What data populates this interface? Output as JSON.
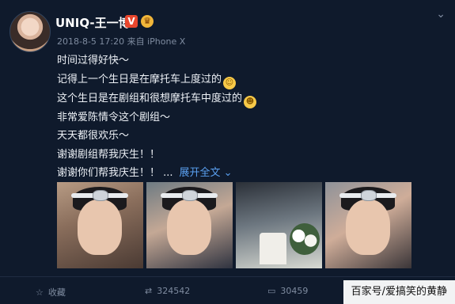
{
  "post": {
    "username": "UNIQ-王一博",
    "verified_badge": "V",
    "meta": "2018-8-5 17:20 来自 iPhone X",
    "lines": [
      "时间过得好快～",
      "记得上一个生日是在摩托车上度过的",
      "这个生日是在剧组和很想摩托车中度过的",
      "非常爱陈情令这个剧组～",
      "天天都很欢乐～",
      "谢谢剧组帮我庆生！！",
      "谢谢你们帮我庆生！！ ..."
    ],
    "expand_label": "展开全文 ⌄"
  },
  "actions": {
    "favorite_label": "收藏",
    "repost_count": "324542",
    "comment_count": "30459"
  },
  "watermark": "百家号/爱搞笑的黄静",
  "icons": [
    "avatar",
    "verified-badge-icon",
    "crown-icon",
    "chevron-down-icon",
    "smile-emoji-icon",
    "laugh-emoji-icon",
    "star-icon",
    "repost-icon",
    "comment-icon"
  ],
  "colors": {
    "background": "#0f1a2c",
    "link": "#5aa0f0",
    "badge": "#e8462d",
    "muted": "#7f8ca0"
  }
}
